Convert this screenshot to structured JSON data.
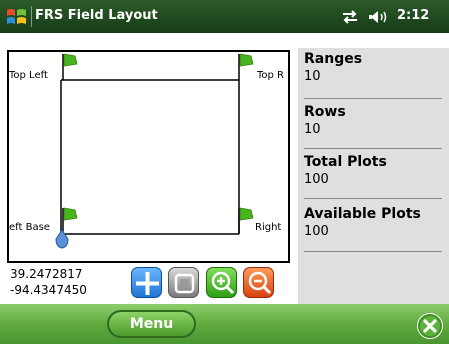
{
  "titlebar": {
    "app_title": "FRS Field Layout",
    "time": "2:12",
    "icons": [
      "windows-start-icon",
      "connectivity-icon",
      "speaker-icon"
    ]
  },
  "map": {
    "corners": {
      "top_left": "Top Left",
      "top_right": "Top R",
      "left_base": "eft Base",
      "right": "Right"
    },
    "flag_color": "#47b51c",
    "marker_color": "#5b8fd6"
  },
  "coordinates": {
    "latitude": "39.2472817",
    "longitude": "-94.4347450"
  },
  "tools": [
    "crosshair-icon",
    "fit-extent-icon",
    "zoom-in-icon",
    "zoom-out-icon"
  ],
  "stats": {
    "ranges_label": "Ranges",
    "ranges_value": "10",
    "rows_label": "Rows",
    "rows_value": "10",
    "total_plots_label": "Total Plots",
    "total_plots_value": "100",
    "available_plots_label": "Available Plots",
    "available_plots_value": "100"
  },
  "bottombar": {
    "menu_label": "Menu",
    "close_icon": "close-icon"
  },
  "colors": {
    "titlebar": "#1f4a1e",
    "bottombar": "#5ea83d",
    "panel": "#dfdfdf"
  }
}
